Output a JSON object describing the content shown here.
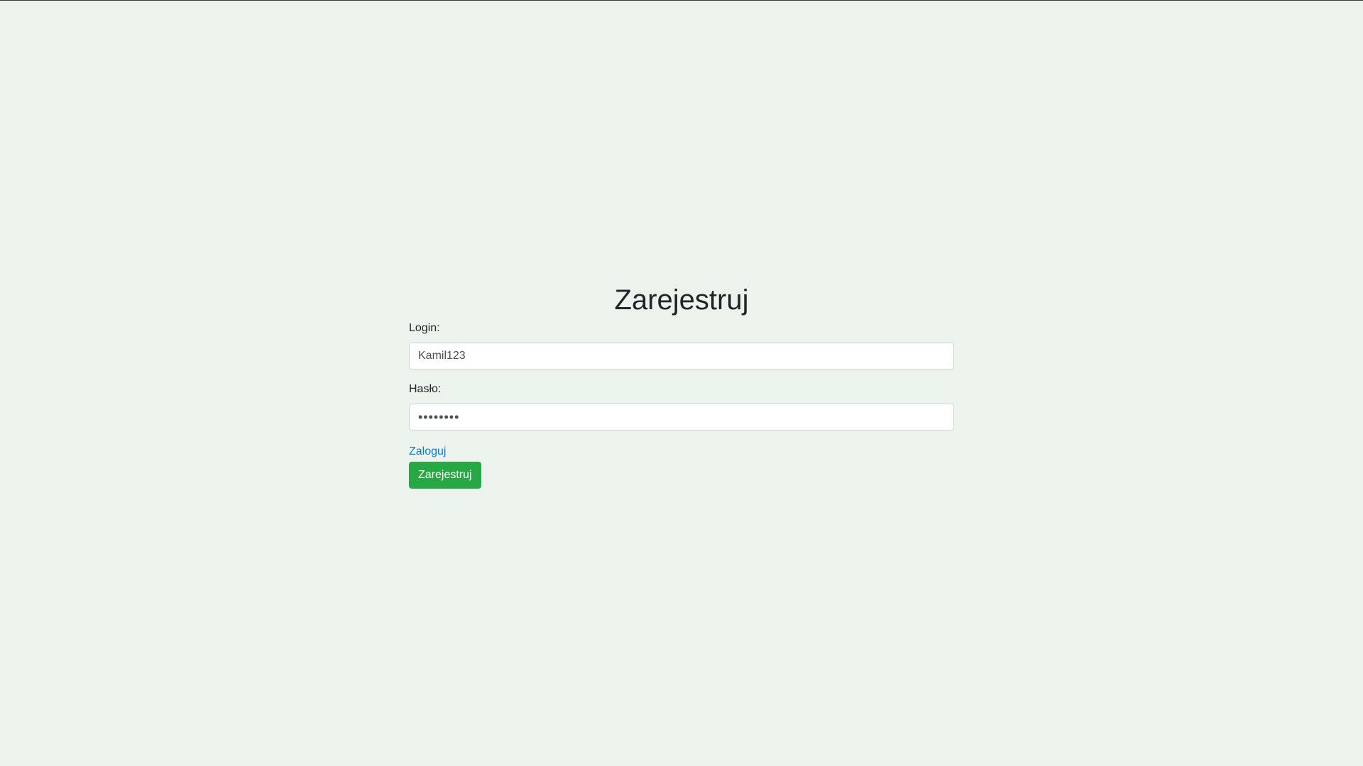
{
  "form": {
    "title": "Zarejestruj",
    "login": {
      "label": "Login:",
      "value": "Kamil123"
    },
    "password": {
      "label": "Hasło:",
      "value": "••••••••"
    },
    "login_link": "Zaloguj",
    "submit_label": "Zarejestruj"
  },
  "colors": {
    "background": "#ecf3ec",
    "button": "#28a745",
    "link": "#0d7ad9"
  }
}
